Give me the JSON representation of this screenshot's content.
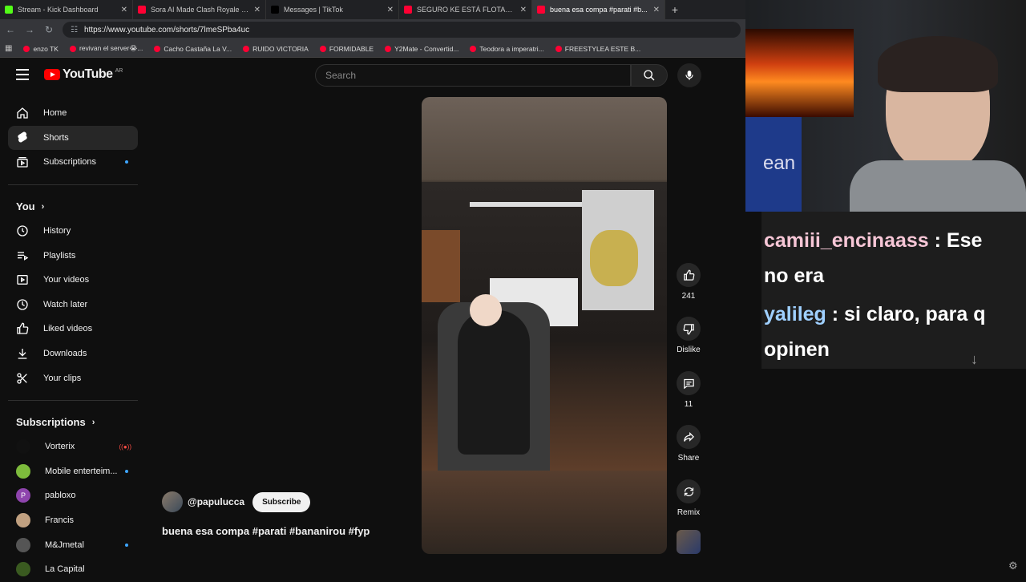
{
  "tabs": [
    {
      "title": "Stream - Kick Dashboard",
      "favicon_color": "#53fc18",
      "active": false
    },
    {
      "title": "Sora AI Made Clash Royale Real 🔥",
      "favicon_color": "#ff0033",
      "active": false
    },
    {
      "title": "Messages | TikTok",
      "favicon_color": "#000000",
      "active": false
    },
    {
      "title": "SEGURO KE ESTÁ FLOTANDO EN...",
      "favicon_color": "#ff0033",
      "active": false
    },
    {
      "title": "buena esa compa #parati #b...",
      "favicon_color": "#ff0033",
      "active": true
    }
  ],
  "address": {
    "url": "https://www.youtube.com/shorts/7lmeSPba4uc"
  },
  "bookmarks": [
    "enzo TK",
    "revivan el server😭...",
    "Cacho Castaña La V...",
    "RUIDO VICTORIA",
    "FORMIDABLE",
    "Y2Mate - Convertid...",
    "Teodora a imperatri...",
    "FREESTYLEA ESTE B..."
  ],
  "header": {
    "logo_text": "YouTube",
    "country_code": "AR",
    "search_placeholder": "Search"
  },
  "sidebar": {
    "main": [
      {
        "label": "Home",
        "icon": "home-icon"
      },
      {
        "label": "Shorts",
        "icon": "shorts-icon",
        "active": true
      },
      {
        "label": "Subscriptions",
        "icon": "subscriptions-icon",
        "dot": true
      }
    ],
    "you_heading": "You",
    "you": [
      {
        "label": "History",
        "icon": "history-icon"
      },
      {
        "label": "Playlists",
        "icon": "playlists-icon"
      },
      {
        "label": "Your videos",
        "icon": "your-videos-icon"
      },
      {
        "label": "Watch later",
        "icon": "watch-later-icon"
      },
      {
        "label": "Liked videos",
        "icon": "liked-videos-icon"
      },
      {
        "label": "Downloads",
        "icon": "downloads-icon"
      },
      {
        "label": "Your clips",
        "icon": "clips-icon"
      }
    ],
    "subs_heading": "Subscriptions",
    "subs": [
      {
        "label": "Vorterix",
        "avatar_color": "#111111",
        "live": true
      },
      {
        "label": "Mobile enterteim...",
        "avatar_color": "#7dbb3c",
        "dot": true
      },
      {
        "label": "pabloxo",
        "avatar_color": "#8e44ad",
        "initial": "P"
      },
      {
        "label": "Francis",
        "avatar_color": "#c0a080"
      },
      {
        "label": "M&Jmetal",
        "avatar_color": "#555555",
        "dot": true
      },
      {
        "label": "La Capital",
        "avatar_color": "#3a5a20"
      }
    ]
  },
  "short": {
    "channel": "@papulucca",
    "subscribe_label": "Subscribe",
    "caption": "buena esa compa #parati #bananirou #fyp",
    "like_count": "241",
    "dislike_label": "Dislike",
    "comment_count": "11",
    "share_label": "Share",
    "remix_label": "Remix"
  },
  "chat": [
    {
      "user": "camiii_encinaass",
      "line1": "Ese",
      "line2": "no era"
    },
    {
      "user": "yalileg",
      "line1": "si claro, para q",
      "line2": "opinen"
    }
  ],
  "webcam_text": "ean"
}
